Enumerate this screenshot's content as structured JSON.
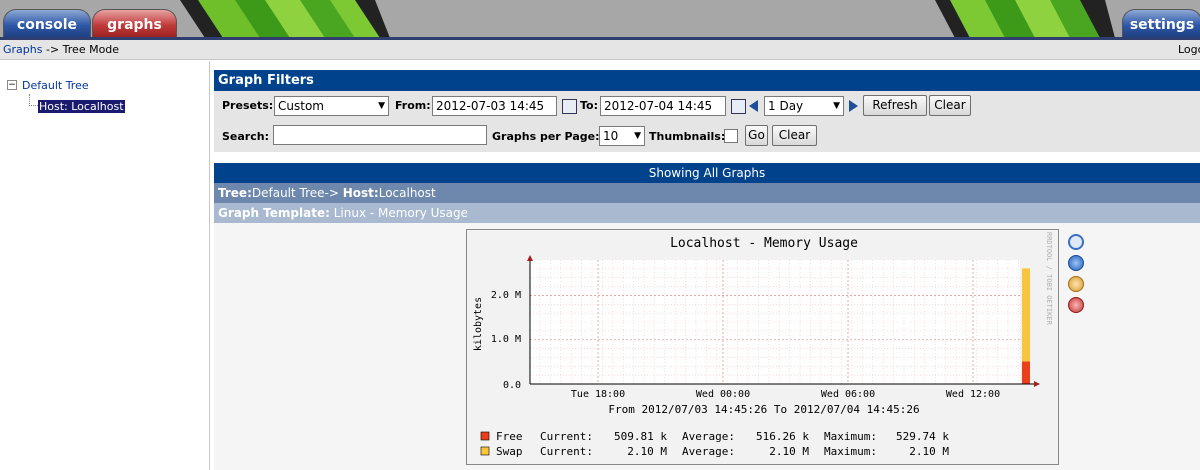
{
  "tabs": {
    "console": "console",
    "graphs": "graphs",
    "settings": "settings"
  },
  "breadcrumb": {
    "link": "Graphs",
    "rest": "-> Tree Mode",
    "login": "Logo"
  },
  "tree": {
    "root": "Default Tree",
    "host": "Host: Localhost"
  },
  "filters": {
    "title": "Graph Filters",
    "presets_label": "Presets:",
    "presets_value": "Custom",
    "from_label": "From:",
    "from_value": "2012-07-03 14:45",
    "to_label": "To:",
    "to_value": "2012-07-04 14:45",
    "timespan_value": "1 Day",
    "refresh": "Refresh",
    "clear": "Clear",
    "search_label": "Search:",
    "search_value": "",
    "per_page_label": "Graphs per Page:",
    "per_page_value": "10",
    "thumbnails_label": "Thumbnails:",
    "go": "Go",
    "clear2": "Clear"
  },
  "showing": "Showing All Graphs",
  "treebar": {
    "tree_label": "Tree:",
    "tree_value": "Default Tree->",
    "host_label": "Host:",
    "host_value": "Localhost"
  },
  "template": {
    "label": "Graph Template:",
    "value": "Linux - Memory Usage"
  },
  "graph": {
    "title": "Localhost - Memory Usage",
    "ylabel": "kilobytes",
    "yticks": [
      "2.0 M",
      "1.0 M",
      "0.0"
    ],
    "xticks": [
      "Tue 18:00",
      "Wed 00:00",
      "Wed 06:00",
      "Wed 12:00"
    ],
    "range": "From 2012/07/03 14:45:26 To 2012/07/04 14:45:26",
    "watermark": "RRDTOOL / TOBI OETIKER",
    "legend": [
      {
        "name": "Free",
        "color": "#ea3f1a",
        "current_label": "Current:",
        "current": "509.81 k",
        "average_label": "Average:",
        "average": "516.26 k",
        "maximum_label": "Maximum:",
        "maximum": "529.74 k"
      },
      {
        "name": "Swap",
        "color": "#f8c53c",
        "current_label": "Current:",
        "current": "2.10 M",
        "average_label": "Average:",
        "average": "2.10 M",
        "maximum_label": "Maximum:",
        "maximum": "2.10 M"
      }
    ]
  },
  "chart_data": {
    "type": "area",
    "title": "Localhost - Memory Usage",
    "ylabel": "kilobytes",
    "ylim": [
      0,
      2800000
    ],
    "series": [
      {
        "name": "Free",
        "color": "#ea3f1a",
        "values": [
          509810
        ]
      },
      {
        "name": "Swap",
        "color": "#f8c53c",
        "values": [
          2100000
        ]
      }
    ]
  },
  "icons": [
    "zoom-icon",
    "move-icon",
    "properties-icon",
    "delete-icon"
  ]
}
